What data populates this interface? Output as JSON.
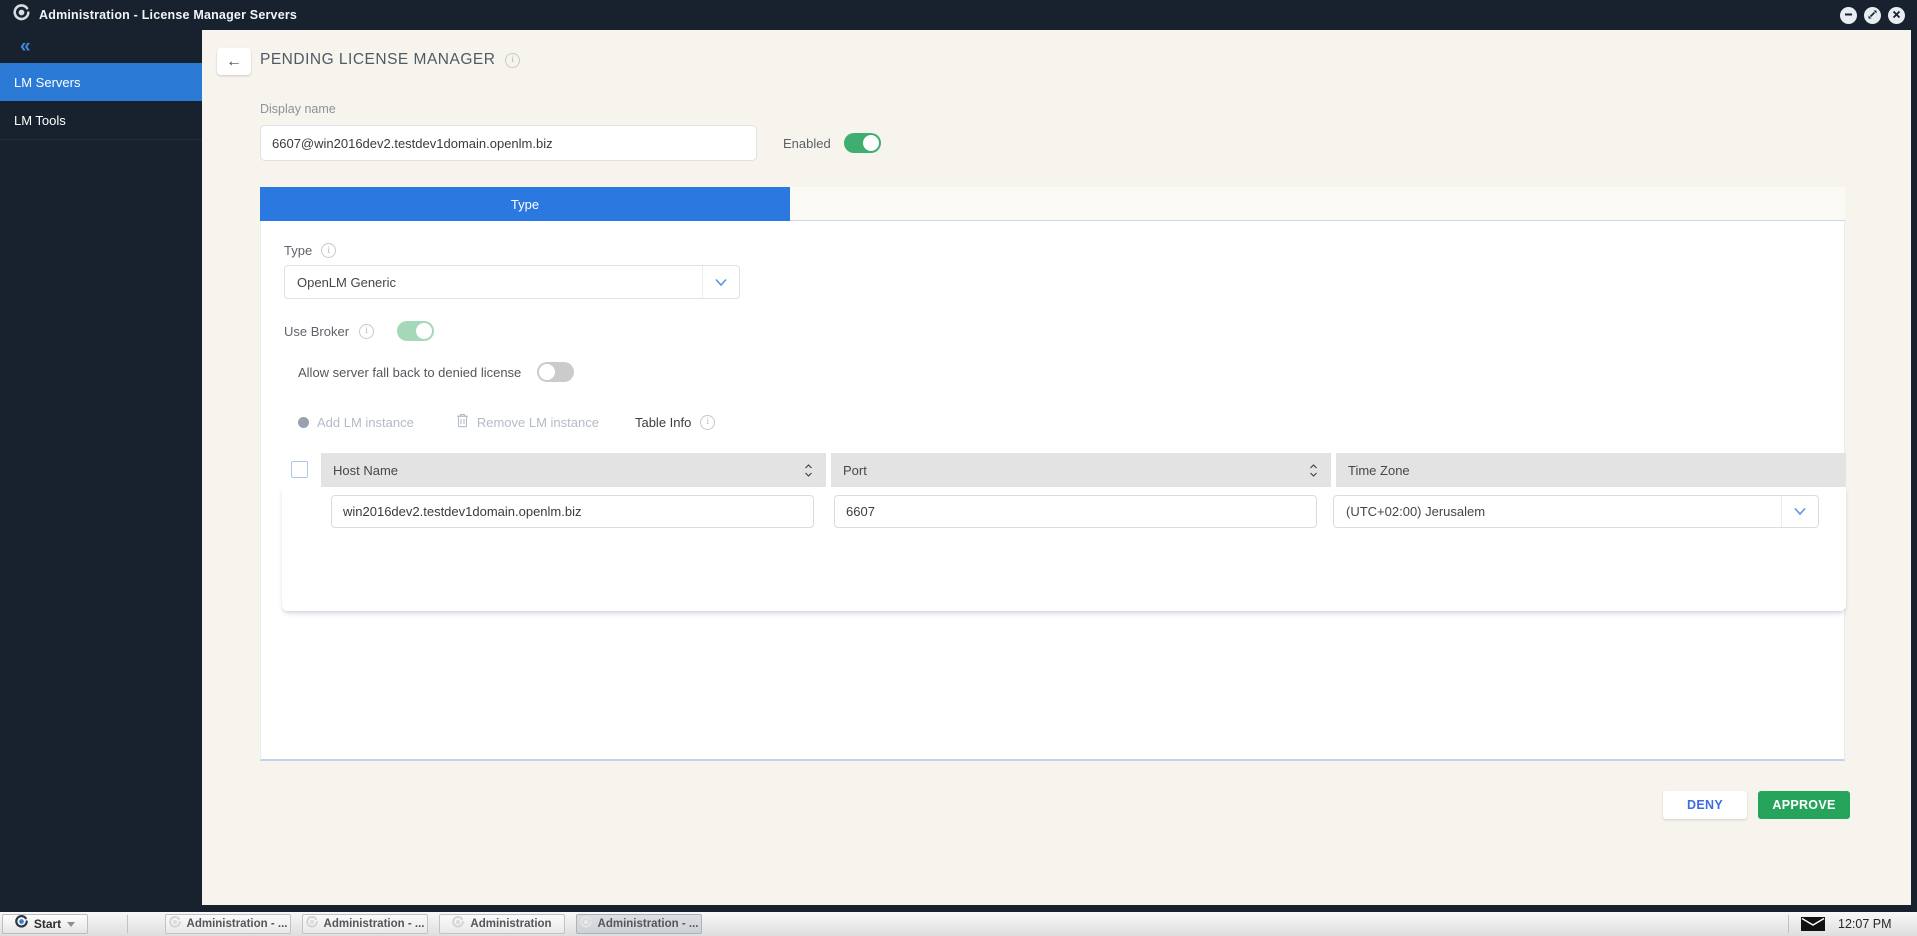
{
  "titlebar": {
    "title": "Administration - License Manager Servers"
  },
  "sidebar": {
    "collapse_glyph": "«",
    "items": [
      {
        "label": "LM Servers",
        "active": true
      },
      {
        "label": "LM Tools",
        "active": false
      }
    ]
  },
  "page": {
    "back_glyph": "←",
    "title": "PENDING LICENSE MANAGER",
    "display_name": {
      "label": "Display name",
      "value": "6607@win2016dev2.testdev1domain.openlm.biz"
    },
    "enabled": {
      "label": "Enabled",
      "on": true
    },
    "tabs": [
      {
        "label": "Type",
        "active": true
      }
    ],
    "form": {
      "type": {
        "label": "Type",
        "value": "OpenLM Generic"
      },
      "use_broker": {
        "label": "Use Broker",
        "on": true
      },
      "fallback": {
        "label": "Allow server fall back to denied license",
        "on": false
      },
      "actions": {
        "add": "Add LM instance",
        "remove": "Remove LM instance",
        "table_info": "Table Info"
      }
    },
    "table": {
      "columns": [
        "Host Name",
        "Port",
        "Time Zone"
      ],
      "rows": [
        {
          "host": "win2016dev2.testdev1domain.openlm.biz",
          "port": "6607",
          "timezone": "(UTC+02:00) Jerusalem"
        }
      ]
    },
    "buttons": {
      "deny": "DENY",
      "approve": "APPROVE"
    }
  },
  "taskbar": {
    "start_label": "Start",
    "items": [
      {
        "label": "Administration - ...",
        "active": false
      },
      {
        "label": "Administration - ...",
        "active": false
      },
      {
        "label": "Administration",
        "active": false
      },
      {
        "label": "Administration - ...",
        "active": true
      }
    ],
    "clock": "12:07 PM"
  },
  "colors": {
    "titlebar_bg": "#17222e",
    "sidebar_selected": "#2b7ad6",
    "content_bg": "#f7f4ee",
    "tab_active": "#2b79e0",
    "toggle_on": "#3fae71",
    "toggle_on_pale": "#a5d8b8",
    "toggle_off": "#cbcbcb",
    "approve_bg": "#27a45b",
    "deny_text": "#3e6be0",
    "table_header_bg": "#e3e3e3"
  }
}
